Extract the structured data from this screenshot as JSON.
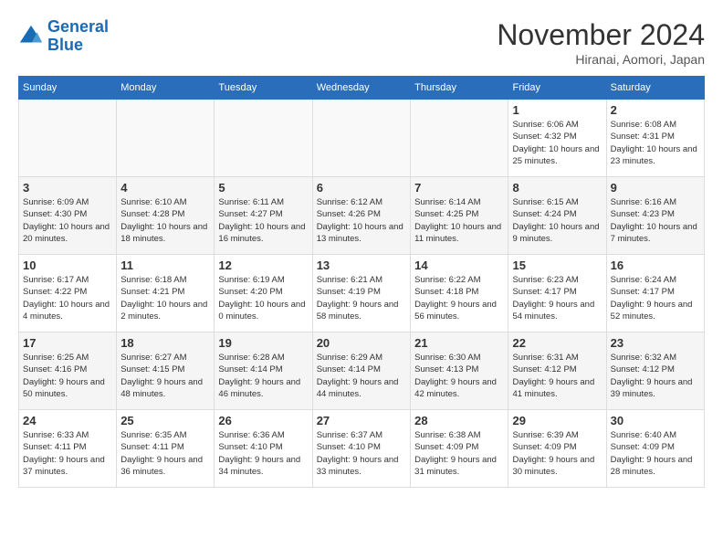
{
  "header": {
    "logo_line1": "General",
    "logo_line2": "Blue",
    "month": "November 2024",
    "location": "Hiranai, Aomori, Japan"
  },
  "weekdays": [
    "Sunday",
    "Monday",
    "Tuesday",
    "Wednesday",
    "Thursday",
    "Friday",
    "Saturday"
  ],
  "weeks": [
    [
      {
        "day": "",
        "info": ""
      },
      {
        "day": "",
        "info": ""
      },
      {
        "day": "",
        "info": ""
      },
      {
        "day": "",
        "info": ""
      },
      {
        "day": "",
        "info": ""
      },
      {
        "day": "1",
        "info": "Sunrise: 6:06 AM\nSunset: 4:32 PM\nDaylight: 10 hours and 25 minutes."
      },
      {
        "day": "2",
        "info": "Sunrise: 6:08 AM\nSunset: 4:31 PM\nDaylight: 10 hours and 23 minutes."
      }
    ],
    [
      {
        "day": "3",
        "info": "Sunrise: 6:09 AM\nSunset: 4:30 PM\nDaylight: 10 hours and 20 minutes."
      },
      {
        "day": "4",
        "info": "Sunrise: 6:10 AM\nSunset: 4:28 PM\nDaylight: 10 hours and 18 minutes."
      },
      {
        "day": "5",
        "info": "Sunrise: 6:11 AM\nSunset: 4:27 PM\nDaylight: 10 hours and 16 minutes."
      },
      {
        "day": "6",
        "info": "Sunrise: 6:12 AM\nSunset: 4:26 PM\nDaylight: 10 hours and 13 minutes."
      },
      {
        "day": "7",
        "info": "Sunrise: 6:14 AM\nSunset: 4:25 PM\nDaylight: 10 hours and 11 minutes."
      },
      {
        "day": "8",
        "info": "Sunrise: 6:15 AM\nSunset: 4:24 PM\nDaylight: 10 hours and 9 minutes."
      },
      {
        "day": "9",
        "info": "Sunrise: 6:16 AM\nSunset: 4:23 PM\nDaylight: 10 hours and 7 minutes."
      }
    ],
    [
      {
        "day": "10",
        "info": "Sunrise: 6:17 AM\nSunset: 4:22 PM\nDaylight: 10 hours and 4 minutes."
      },
      {
        "day": "11",
        "info": "Sunrise: 6:18 AM\nSunset: 4:21 PM\nDaylight: 10 hours and 2 minutes."
      },
      {
        "day": "12",
        "info": "Sunrise: 6:19 AM\nSunset: 4:20 PM\nDaylight: 10 hours and 0 minutes."
      },
      {
        "day": "13",
        "info": "Sunrise: 6:21 AM\nSunset: 4:19 PM\nDaylight: 9 hours and 58 minutes."
      },
      {
        "day": "14",
        "info": "Sunrise: 6:22 AM\nSunset: 4:18 PM\nDaylight: 9 hours and 56 minutes."
      },
      {
        "day": "15",
        "info": "Sunrise: 6:23 AM\nSunset: 4:17 PM\nDaylight: 9 hours and 54 minutes."
      },
      {
        "day": "16",
        "info": "Sunrise: 6:24 AM\nSunset: 4:17 PM\nDaylight: 9 hours and 52 minutes."
      }
    ],
    [
      {
        "day": "17",
        "info": "Sunrise: 6:25 AM\nSunset: 4:16 PM\nDaylight: 9 hours and 50 minutes."
      },
      {
        "day": "18",
        "info": "Sunrise: 6:27 AM\nSunset: 4:15 PM\nDaylight: 9 hours and 48 minutes."
      },
      {
        "day": "19",
        "info": "Sunrise: 6:28 AM\nSunset: 4:14 PM\nDaylight: 9 hours and 46 minutes."
      },
      {
        "day": "20",
        "info": "Sunrise: 6:29 AM\nSunset: 4:14 PM\nDaylight: 9 hours and 44 minutes."
      },
      {
        "day": "21",
        "info": "Sunrise: 6:30 AM\nSunset: 4:13 PM\nDaylight: 9 hours and 42 minutes."
      },
      {
        "day": "22",
        "info": "Sunrise: 6:31 AM\nSunset: 4:12 PM\nDaylight: 9 hours and 41 minutes."
      },
      {
        "day": "23",
        "info": "Sunrise: 6:32 AM\nSunset: 4:12 PM\nDaylight: 9 hours and 39 minutes."
      }
    ],
    [
      {
        "day": "24",
        "info": "Sunrise: 6:33 AM\nSunset: 4:11 PM\nDaylight: 9 hours and 37 minutes."
      },
      {
        "day": "25",
        "info": "Sunrise: 6:35 AM\nSunset: 4:11 PM\nDaylight: 9 hours and 36 minutes."
      },
      {
        "day": "26",
        "info": "Sunrise: 6:36 AM\nSunset: 4:10 PM\nDaylight: 9 hours and 34 minutes."
      },
      {
        "day": "27",
        "info": "Sunrise: 6:37 AM\nSunset: 4:10 PM\nDaylight: 9 hours and 33 minutes."
      },
      {
        "day": "28",
        "info": "Sunrise: 6:38 AM\nSunset: 4:09 PM\nDaylight: 9 hours and 31 minutes."
      },
      {
        "day": "29",
        "info": "Sunrise: 6:39 AM\nSunset: 4:09 PM\nDaylight: 9 hours and 30 minutes."
      },
      {
        "day": "30",
        "info": "Sunrise: 6:40 AM\nSunset: 4:09 PM\nDaylight: 9 hours and 28 minutes."
      }
    ]
  ]
}
